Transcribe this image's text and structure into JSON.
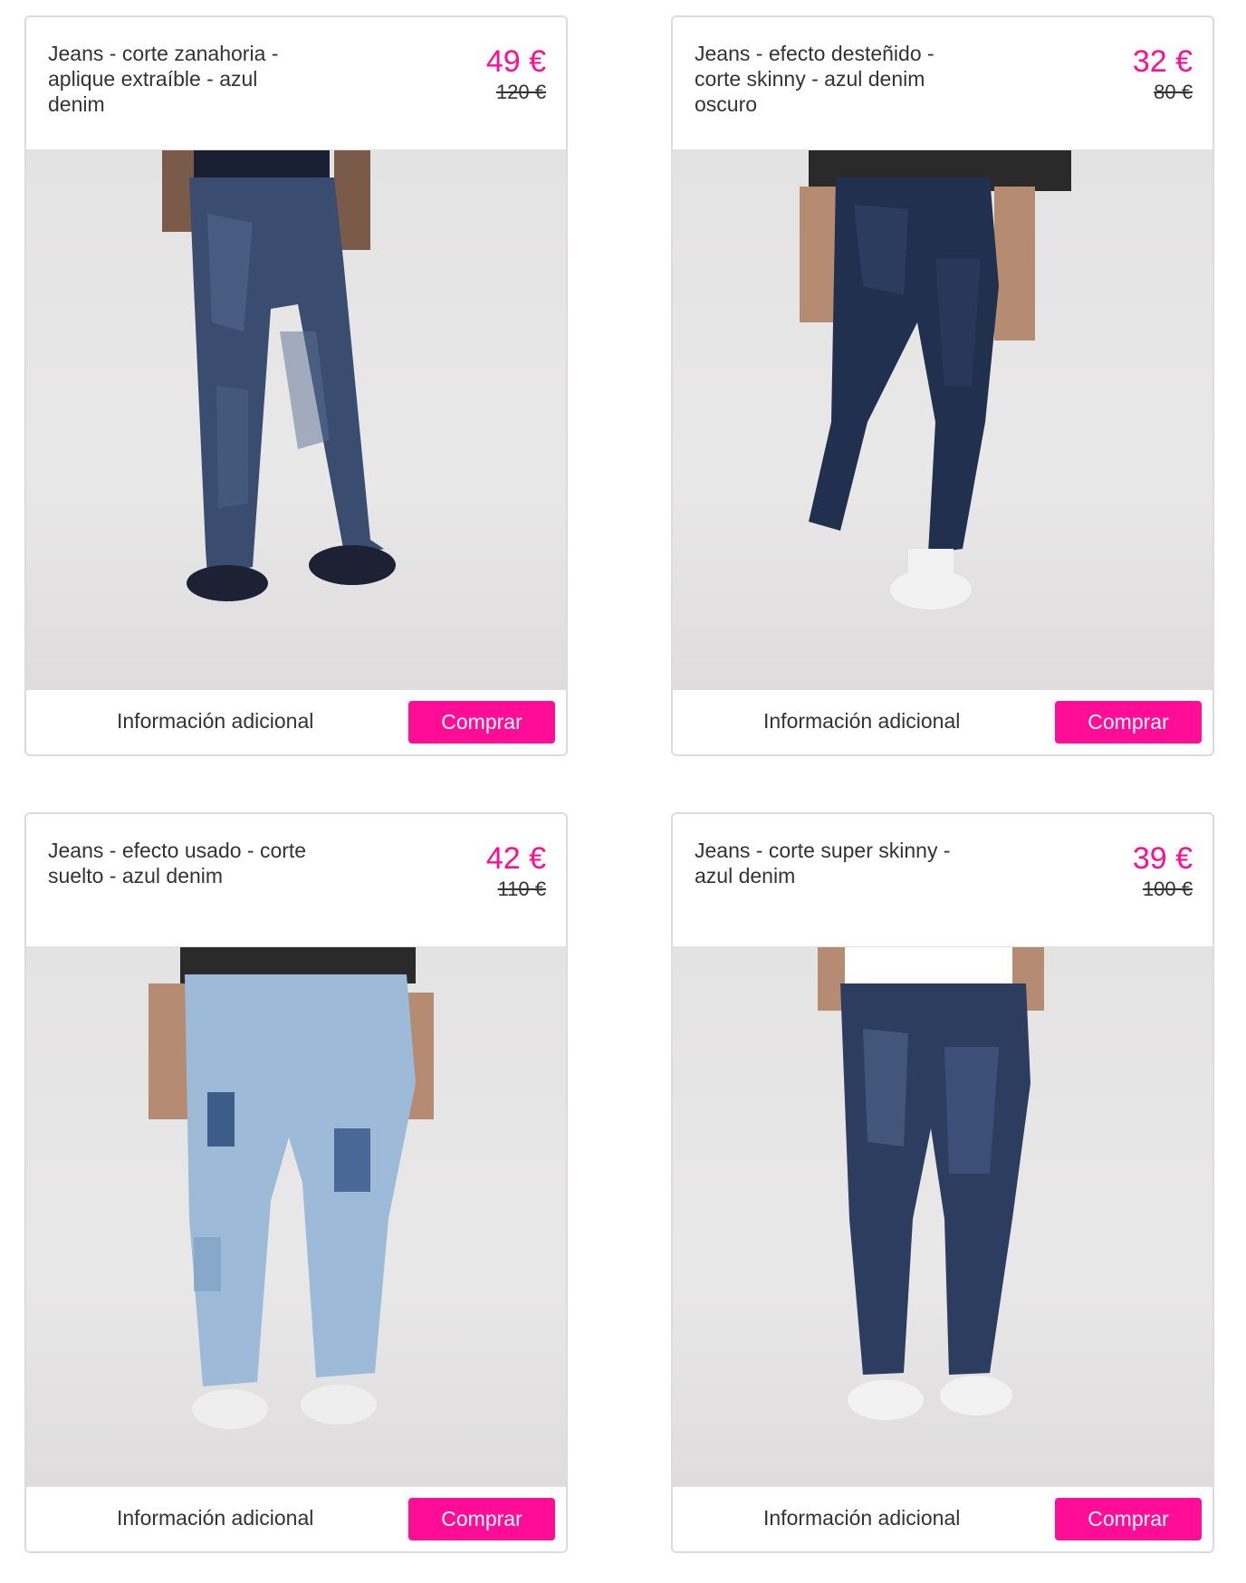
{
  "products": [
    {
      "title": "Jeans - corte zanahoria - aplique extraíble - azul denim",
      "price": "49 €",
      "old_price": "120 €",
      "info_label": "Información adicional",
      "buy_label": "Comprar",
      "image_alt": "jeans-photo"
    },
    {
      "title": "Jeans - efecto desteñido - corte skinny - azul denim oscuro",
      "price": "32 €",
      "old_price": "80 €",
      "info_label": "Información adicional",
      "buy_label": "Comprar",
      "image_alt": "jeans-photo"
    },
    {
      "title": "Jeans - efecto usado - corte suelto - azul denim",
      "price": "42 €",
      "old_price": "110 €",
      "info_label": "Información adicional",
      "buy_label": "Comprar",
      "image_alt": "jeans-photo"
    },
    {
      "title": "Jeans - corte super skinny - azul denim",
      "price": "39 €",
      "old_price": "100 €",
      "info_label": "Información adicional",
      "buy_label": "Comprar",
      "image_alt": "jeans-photo"
    }
  ],
  "colors": {
    "accent": "#ff0d96",
    "text": "#333333",
    "border": "#dcdcdc",
    "photo_background": "#e6e5e5"
  }
}
